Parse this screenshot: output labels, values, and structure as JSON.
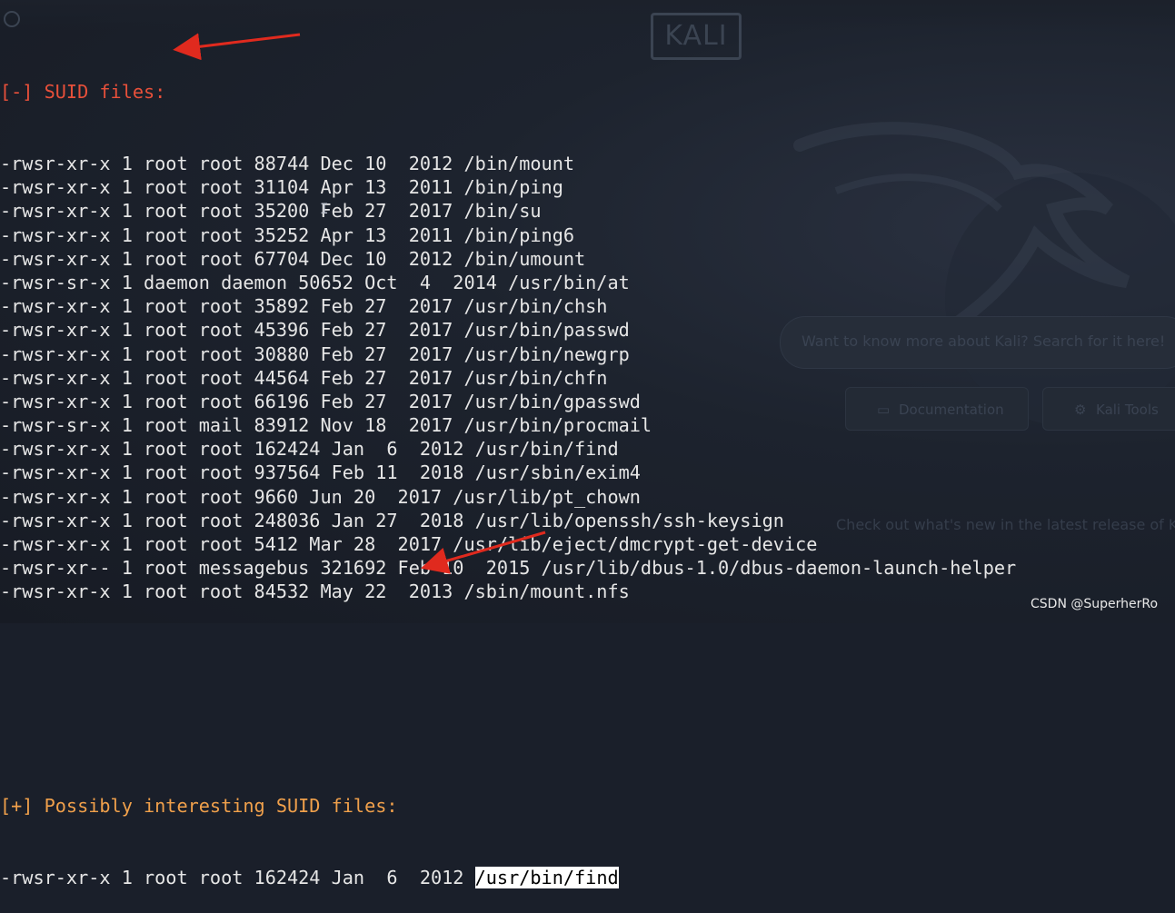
{
  "background": {
    "logo_text": "KALI",
    "search_placeholder": "Want to know more about Kali? Search for it here!",
    "buttons": [
      {
        "label": "Documentation",
        "icon": "book-icon"
      },
      {
        "label": "Kali Tools",
        "icon": "gear-icon"
      }
    ],
    "tagline": "Check out what's new in the latest release of Kali"
  },
  "terminal": {
    "suid_header": "[-] SUID files:",
    "suid_files": [
      "-rwsr-xr-x 1 root root 88744 Dec 10  2012 /bin/mount",
      "-rwsr-xr-x 1 root root 31104 Apr 13  2011 /bin/ping",
      "-rwsr-xr-x 1 root root 35200 Feb 27  2017 /bin/su",
      "-rwsr-xr-x 1 root root 35252 Apr 13  2011 /bin/ping6",
      "-rwsr-xr-x 1 root root 67704 Dec 10  2012 /bin/umount",
      "-rwsr-sr-x 1 daemon daemon 50652 Oct  4  2014 /usr/bin/at",
      "-rwsr-xr-x 1 root root 35892 Feb 27  2017 /usr/bin/chsh",
      "-rwsr-xr-x 1 root root 45396 Feb 27  2017 /usr/bin/passwd",
      "-rwsr-xr-x 1 root root 30880 Feb 27  2017 /usr/bin/newgrp",
      "-rwsr-xr-x 1 root root 44564 Feb 27  2017 /usr/bin/chfn",
      "-rwsr-xr-x 1 root root 66196 Feb 27  2017 /usr/bin/gpasswd",
      "-rwsr-sr-x 1 root mail 83912 Nov 18  2017 /usr/bin/procmail",
      "-rwsr-xr-x 1 root root 162424 Jan  6  2012 /usr/bin/find",
      "-rwsr-xr-x 1 root root 937564 Feb 11  2018 /usr/sbin/exim4",
      "-rwsr-xr-x 1 root root 9660 Jun 20  2017 /usr/lib/pt_chown",
      "-rwsr-xr-x 1 root root 248036 Jan 27  2018 /usr/lib/openssh/ssh-keysign",
      "-rwsr-xr-x 1 root root 5412 Mar 28  2017 /usr/lib/eject/dmcrypt-get-device",
      "-rwsr-xr-- 1 root messagebus 321692 Feb 10  2015 /usr/lib/dbus-1.0/dbus-daemon-launch-helper",
      "-rwsr-xr-x 1 root root 84532 May 22  2013 /sbin/mount.nfs"
    ],
    "interesting_header": "[+] Possibly interesting SUID files:",
    "interesting_prefix": "-rwsr-xr-x 1 root root 162424 Jan  6  2012 ",
    "interesting_path": "/usr/bin/find"
  },
  "watermark": "CSDN @SuperherRo",
  "colors": {
    "background": "#1a1f2a",
    "terminal_text": "#e6e6e6",
    "header_red": "#e8503a",
    "header_orange": "#f0a04b",
    "annotation_arrow": "#e02a1e",
    "selection": "#ffffff"
  }
}
